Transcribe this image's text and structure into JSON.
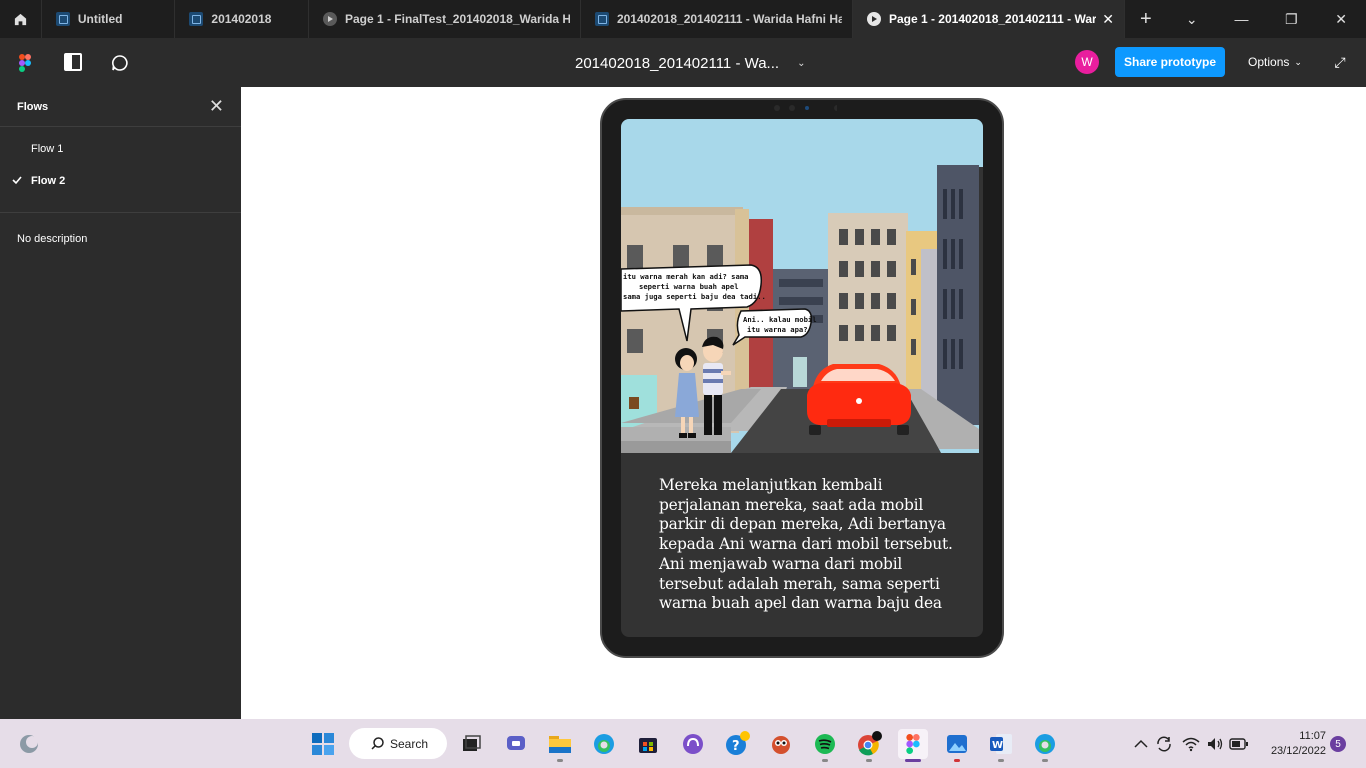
{
  "tabs": [
    {
      "label": "Untitled",
      "icon": "file-icon"
    },
    {
      "label": "201402018",
      "icon": "file-icon"
    },
    {
      "label": "Page 1 - FinalTest_201402018_Warida Ha",
      "icon": "play-icon"
    },
    {
      "label": "201402018_201402111 - Warida Hafni Ha",
      "icon": "file-icon"
    },
    {
      "label": "Page 1 - 201402018_201402111 - Warid",
      "icon": "play-icon",
      "active": true
    }
  ],
  "toolbar": {
    "file_title": "201402018_201402111 - Wa...",
    "avatar_initial": "W",
    "share_label": "Share prototype",
    "options_label": "Options"
  },
  "sidebar": {
    "title": "Flows",
    "flows": [
      {
        "label": "Flow 1",
        "selected": false
      },
      {
        "label": "Flow 2",
        "selected": true
      }
    ],
    "description": "No description"
  },
  "slide": {
    "bubble_1": "itu warna merah kan adi? sama seperti warna buah apel sama juga seperti baju dea tadi..",
    "bubble_2": "Ani.. kalau mobil itu warna apa?",
    "story": "Mereka melanjutkan kembali perjalanan mereka, saat ada mobil parkir di depan mereka, Adi bertanya kepada Ani warna dari mobil tersebut. Ani menjawab warna dari mobil tersebut adalah merah, sama seperti warna buah apel dan warna baju dea"
  },
  "taskbar": {
    "search_label": "Search",
    "time": "11:07",
    "date": "23/12/2022",
    "notifications": "5"
  },
  "colors": {
    "accent": "#0d99ff",
    "avatar": "#e91e9e",
    "car": "#ff2a10",
    "sky": "#a8d8ea"
  }
}
